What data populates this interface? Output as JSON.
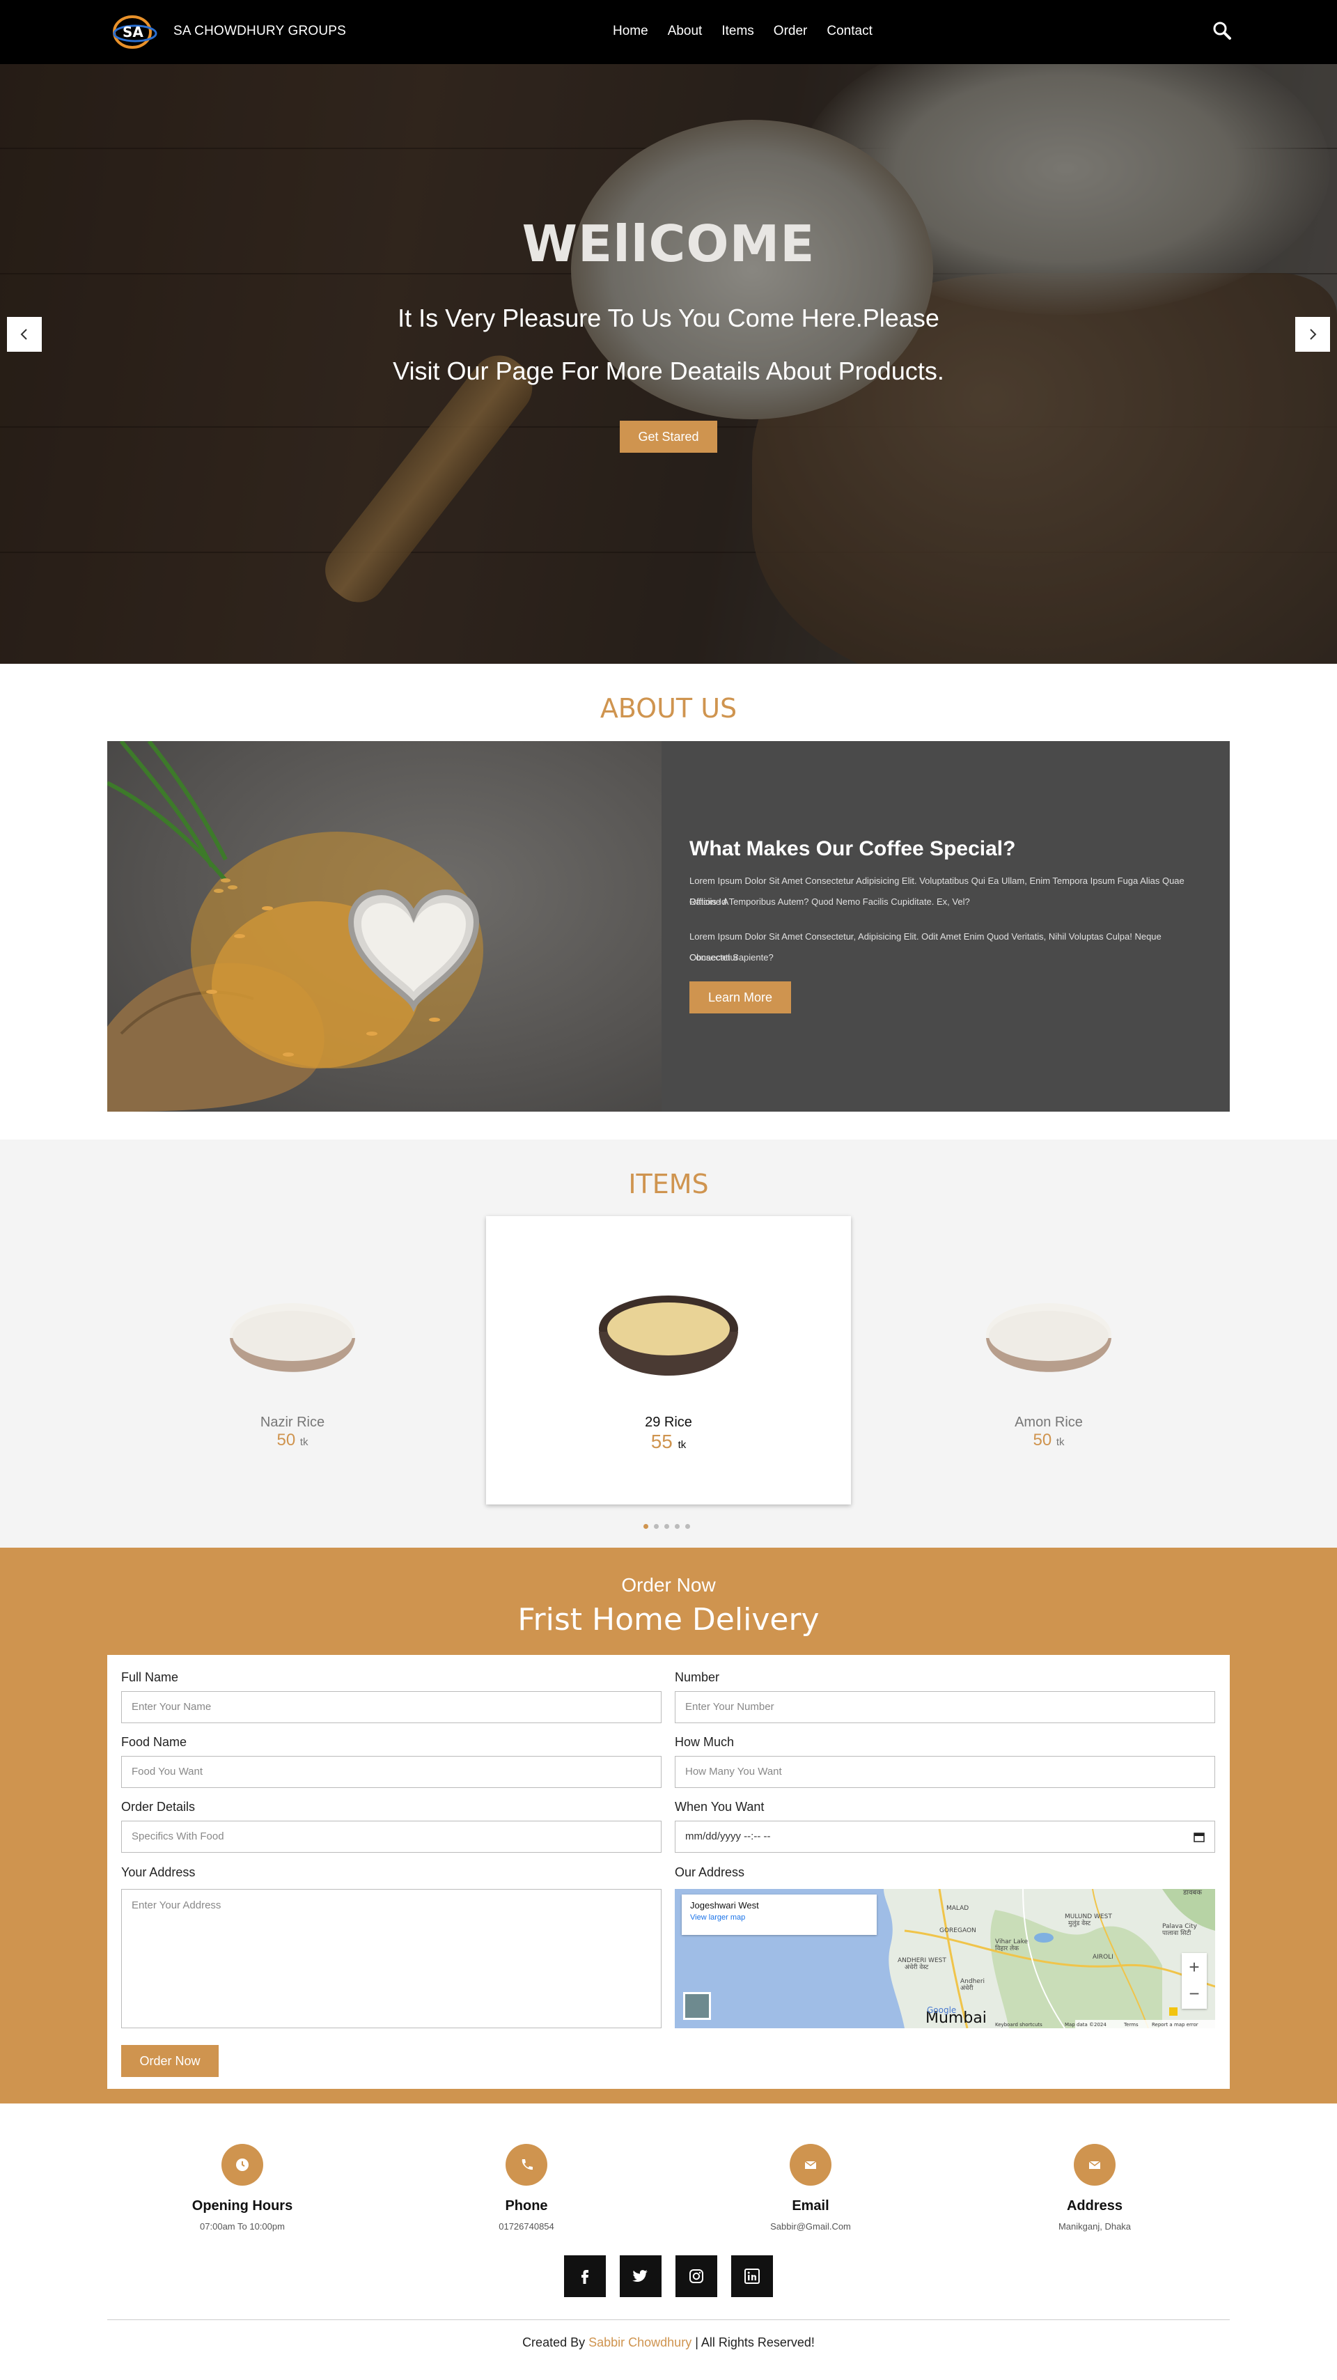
{
  "nav": {
    "brand": "SA CHOWDHURY GROUPS",
    "logo_text": "SA",
    "links": [
      "Home",
      "About",
      "Items",
      "Order",
      "Contact"
    ],
    "search_icon": "search-icon"
  },
  "hero": {
    "title": "WEllCOME",
    "line1": "It Is Very Pleasure To Us You Come Here.Please",
    "line2": "Visit Our Page For More Deatails About Products.",
    "button": "Get Stared",
    "prev_icon": "chevron-left-icon",
    "next_icon": "chevron-right-icon"
  },
  "about": {
    "section_title": "ABOUT US",
    "heading": "What Makes Our Coffee Special?",
    "para1_line1": "Lorem Ipsum Dolor Sit Amet Consectetur Adipisicing Elit. Voluptatibus Qui Ea Ullam, Enim Tempora Ipsum Fuga Alias Quae Ratione A",
    "para1_line2": "Officiis Id Temporibus Autem? Quod Nemo Facilis Cupiditate. Ex, Vel?",
    "para2_line1": "Lorem Ipsum Dolor Sit Amet Consectetur, Adipisicing Elit. Odit Amet Enim Quod Veritatis, Nihil Voluptas Culpa! Neque Consectetur",
    "para2_line2": "Obcaecati Sapiente?",
    "button": "Learn More"
  },
  "items": {
    "section_title": "ITEMS",
    "list": [
      {
        "name": "Nazir Rice",
        "price": "50",
        "unit": "tk"
      },
      {
        "name": "29 Rice",
        "price": "55",
        "unit": "tk"
      },
      {
        "name": "Amon Rice",
        "price": "50",
        "unit": "tk"
      }
    ],
    "dots_count": 5,
    "active_dot": 0
  },
  "order": {
    "subtitle": "Order Now",
    "title": "Frist Home Delivery",
    "fields": {
      "full_name": {
        "label": "Full Name",
        "placeholder": "Enter Your Name"
      },
      "number": {
        "label": "Number",
        "placeholder": "Enter Your Number"
      },
      "food_name": {
        "label": "Food Name",
        "placeholder": "Food You Want"
      },
      "how_much": {
        "label": "How Much",
        "placeholder": "How Many You Want"
      },
      "order_details": {
        "label": "Order Details",
        "placeholder": "Specifics With Food"
      },
      "when": {
        "label": "When You Want",
        "placeholder": "mm/dd/yyyy --:-- --"
      },
      "address": {
        "label": "Your Address",
        "placeholder": "Enter Your Address"
      },
      "our_address": {
        "label": "Our Address"
      }
    },
    "map": {
      "place": "Jogeshwari West",
      "view_larger": "View larger map",
      "labels": [
        "डावबक",
        "MULUND WEST",
        "मुलुंड वेस्ट",
        "Palava City",
        "पालावा सिटी",
        "GOREGAON",
        "Vihar Lake",
        "विहार लेक",
        "AIROLI",
        "ANDHERI WEST",
        "अंधेरी वेस्ट",
        "Andheri",
        "अंधेरी",
        "Mumbai",
        "MALAD",
        "Google"
      ],
      "footer": [
        "Keyboard shortcuts",
        "Map data ©2024",
        "Terms",
        "Report a map error"
      ],
      "zoom_in": "+",
      "zoom_out": "−"
    },
    "button": "Order Now"
  },
  "contact": {
    "items": [
      {
        "title": "Opening Hours",
        "value": "07:00am To 10:00pm",
        "icon": "clock-icon"
      },
      {
        "title": "Phone",
        "value": "01726740854",
        "icon": "phone-icon"
      },
      {
        "title": "Email",
        "value": "Sabbir@Gmail.Com",
        "icon": "envelope-icon"
      },
      {
        "title": "Address",
        "value": "Manikganj, Dhaka",
        "icon": "envelope-icon"
      }
    ],
    "social": [
      "facebook-icon",
      "twitter-icon",
      "instagram-icon",
      "linkedin-icon"
    ]
  },
  "footer": {
    "prefix": "Created By ",
    "author": "Sabbir Chowdhury",
    "suffix": " | All Rights Reserved!"
  },
  "colors": {
    "accent": "#cf944f",
    "dark": "#000000",
    "panel": "#4a4a4a"
  }
}
